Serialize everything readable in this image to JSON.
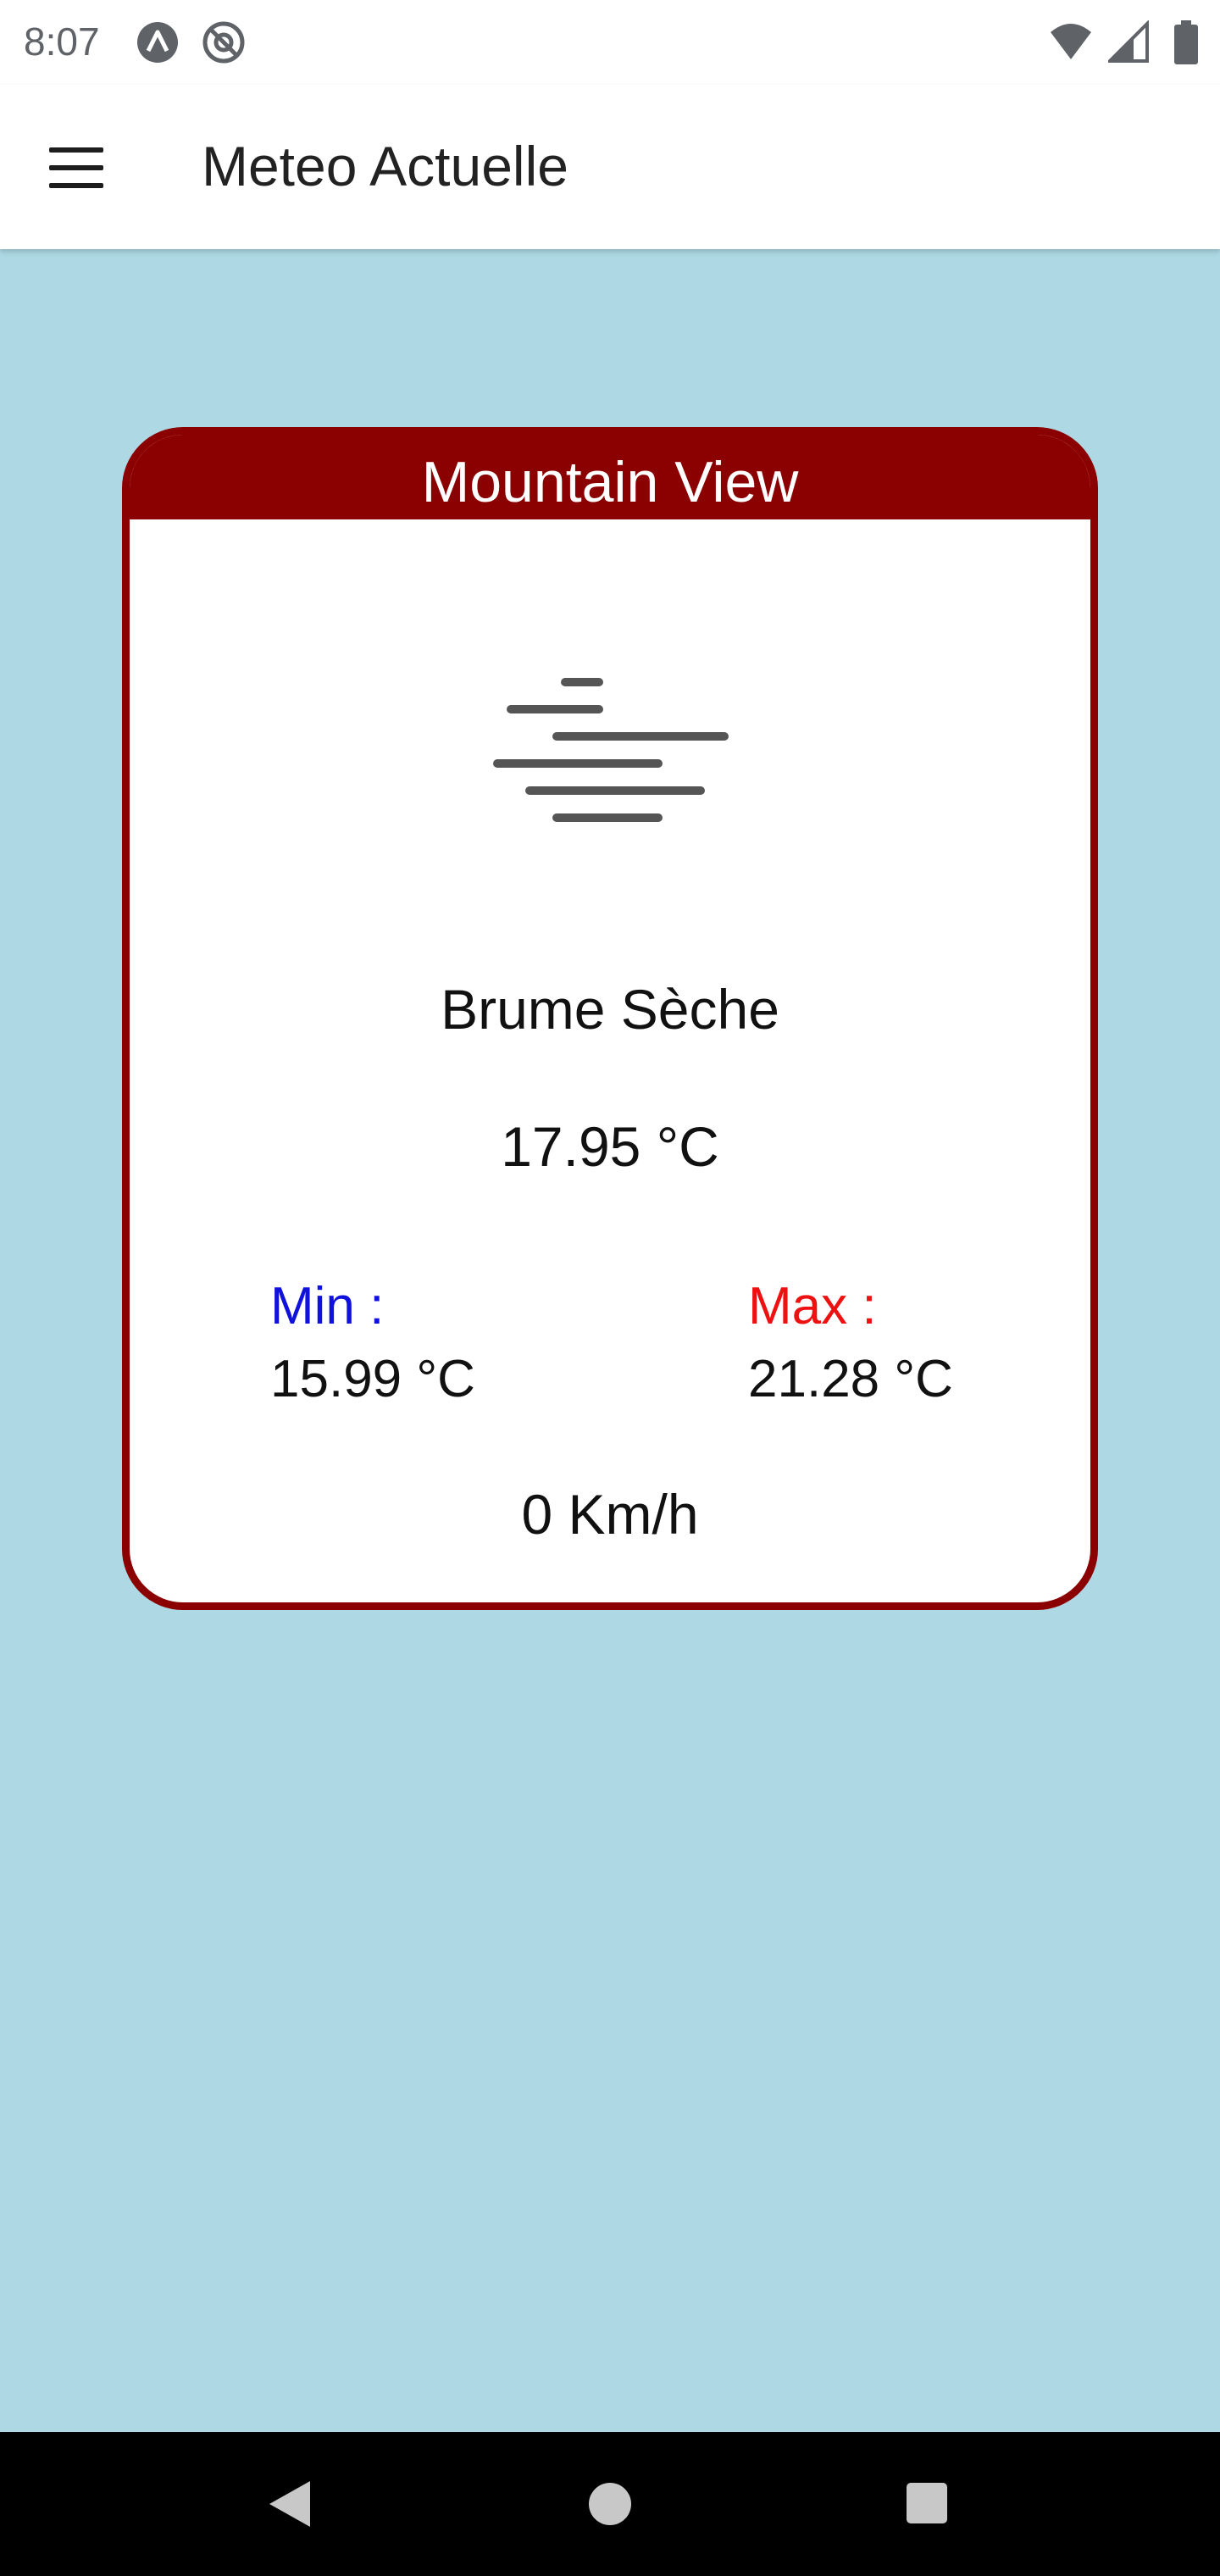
{
  "status_bar": {
    "time": "8:07",
    "icons": [
      "app-notification-icon",
      "at-sign-icon",
      "wifi-icon",
      "cellular-signal-icon",
      "battery-icon"
    ]
  },
  "app_bar": {
    "menu_icon": "hamburger-menu-icon",
    "title": "Meteo Actuelle"
  },
  "weather_card": {
    "city": "Mountain View",
    "icon": "haze-icon",
    "condition": "Brume Sèche",
    "temperature": "17.95 °C",
    "min_label": "Min :",
    "min_value": "15.99 °C",
    "max_label": "Max :",
    "max_value": "21.28 °C",
    "wind": "0 Km/h"
  },
  "nav_bar": {
    "buttons": [
      "back-icon",
      "home-icon",
      "recents-icon"
    ]
  },
  "colors": {
    "background": "#ADD8E4",
    "card_accent": "#8B0000",
    "min_label": "#1111DD",
    "max_label": "#EE1111"
  }
}
